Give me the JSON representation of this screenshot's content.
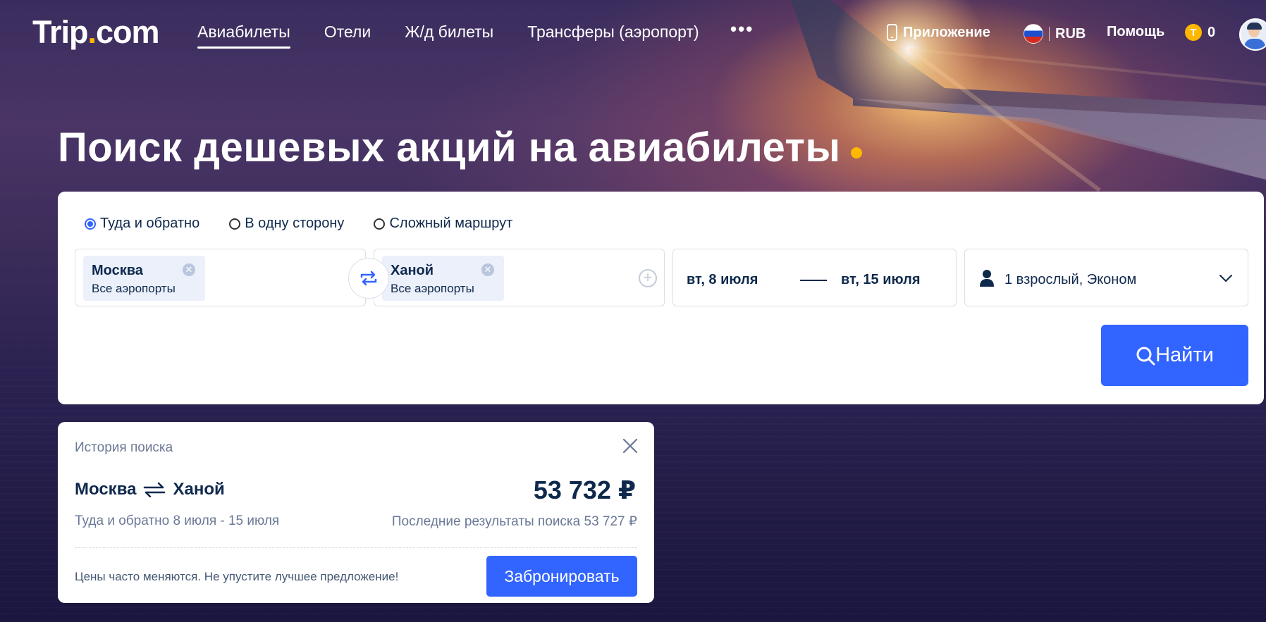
{
  "header": {
    "logo": {
      "text": "Trip",
      "dot": ".",
      "suffix": "com"
    },
    "nav": [
      {
        "label": "Авиабилеты",
        "active": true
      },
      {
        "label": "Отели"
      },
      {
        "label": "Ж/д билеты"
      },
      {
        "label": "Трансферы (аэропорт)"
      }
    ],
    "more": "•••",
    "app_label": "Приложение",
    "currency": "RUB",
    "help": "Помощь",
    "coins": "0"
  },
  "hero": {
    "headline": "Поиск дешевых акций на авиабилеты"
  },
  "search": {
    "trip_types": [
      {
        "label": "Туда и обратно",
        "selected": true
      },
      {
        "label": "В одну сторону",
        "selected": false
      },
      {
        "label": "Сложный маршрут",
        "selected": false
      }
    ],
    "from": {
      "city": "Москва",
      "airports": "Все аэропорты"
    },
    "to": {
      "city": "Ханой",
      "airports": "Все аэропорты"
    },
    "depart_date": "вт, 8 июля",
    "return_date": "вт, 15 июля",
    "passengers": "1 взрослый, Эконом",
    "button": "Найти"
  },
  "history": {
    "title": "История поиска",
    "from": "Москва",
    "to": "Ханой",
    "price": "53 732 ₽",
    "trip_meta": "Туда и обратно  8 июля - 15 июля",
    "last_results": "Последние результаты поиска 53 727 ₽",
    "note": "Цены часто меняются. Не упустите лучшее предложение!",
    "book_button": "Забронировать"
  },
  "colors": {
    "accent": "#3264ff",
    "brand_dot": "#ffb700",
    "text": "#0f294d"
  }
}
